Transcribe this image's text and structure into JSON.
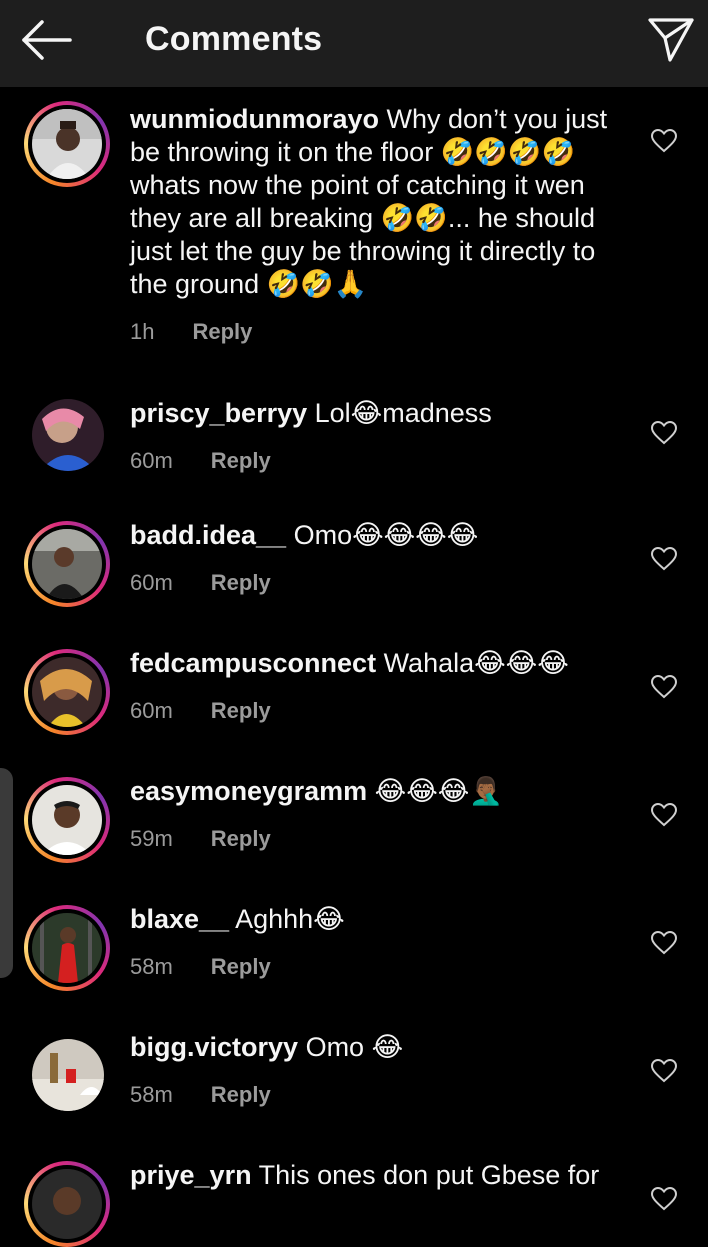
{
  "header": {
    "title": "Comments",
    "back_icon": "arrow-left-icon",
    "share_icon": "paper-plane-icon"
  },
  "colors": {
    "background": "#000000",
    "topbar": "#1e1e1e",
    "text": "#f5f5f5",
    "muted": "#9b9b9b"
  },
  "comments": [
    {
      "username": "wunmiodunmorayo",
      "text": "Why don’t you just be throwing it on the floor 🤣🤣🤣🤣 whats now the point of catching it wen they are all breaking 🤣🤣... he should just let the guy be throwing it directly to the ground 🤣🤣🙏",
      "time": "1h",
      "reply": "Reply"
    },
    {
      "username": "priscy_berryy",
      "text": "Lol😂madness",
      "time": "60m",
      "reply": "Reply"
    },
    {
      "username": "badd.idea__",
      "text": "Omo😂😂😂😂",
      "time": "60m",
      "reply": "Reply"
    },
    {
      "username": "fedcampusconnect",
      "text": "Wahala😂😂😂",
      "time": "60m",
      "reply": "Reply"
    },
    {
      "username": "easymoneygramm",
      "text": "😂😂😂🤦🏾‍♂️",
      "time": "59m",
      "reply": "Reply"
    },
    {
      "username": "blaxe__",
      "text": "Aghhh😂",
      "time": "58m",
      "reply": "Reply"
    },
    {
      "username": "bigg.victoryy",
      "text": "Omo 😂",
      "time": "58m",
      "reply": "Reply"
    },
    {
      "username": "priye_yrn",
      "text": "This ones don put Gbese for",
      "time": "",
      "reply": ""
    }
  ]
}
